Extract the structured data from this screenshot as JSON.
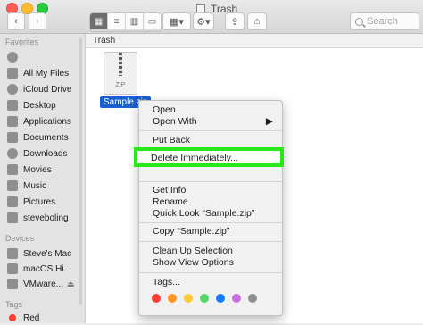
{
  "window": {
    "title": "Trash",
    "search_placeholder": "Search"
  },
  "sidebar": {
    "favorites_heading": "Favorites",
    "favorites": [
      "All My Files",
      "iCloud Drive",
      "Desktop",
      "Applications",
      "Documents",
      "Downloads",
      "Movies",
      "Music",
      "Pictures",
      "steveboling"
    ],
    "devices_heading": "Devices",
    "devices": [
      "Steve's Mac",
      "macOS Hi...",
      "VMware..."
    ],
    "tags_heading": "Tags",
    "tags": [
      "Red"
    ]
  },
  "content": {
    "path_title": "Trash",
    "file_type_label": "ZIP",
    "file_name": "Sample.zip"
  },
  "context_menu": {
    "open": "Open",
    "open_with": "Open With",
    "put_back": "Put Back",
    "delete_immediately": "Delete Immediately...",
    "get_info": "Get Info",
    "rename": "Rename",
    "quick_look": "Quick Look “Sample.zip”",
    "copy": "Copy “Sample.zip”",
    "cleanup": "Clean Up Selection",
    "view_options": "Show View Options",
    "tags": "Tags...",
    "tag_colors": [
      "#fc3d39",
      "#fd9426",
      "#fecb2e",
      "#53d769",
      "#147efb",
      "#c86edf",
      "#8e8e93"
    ]
  }
}
